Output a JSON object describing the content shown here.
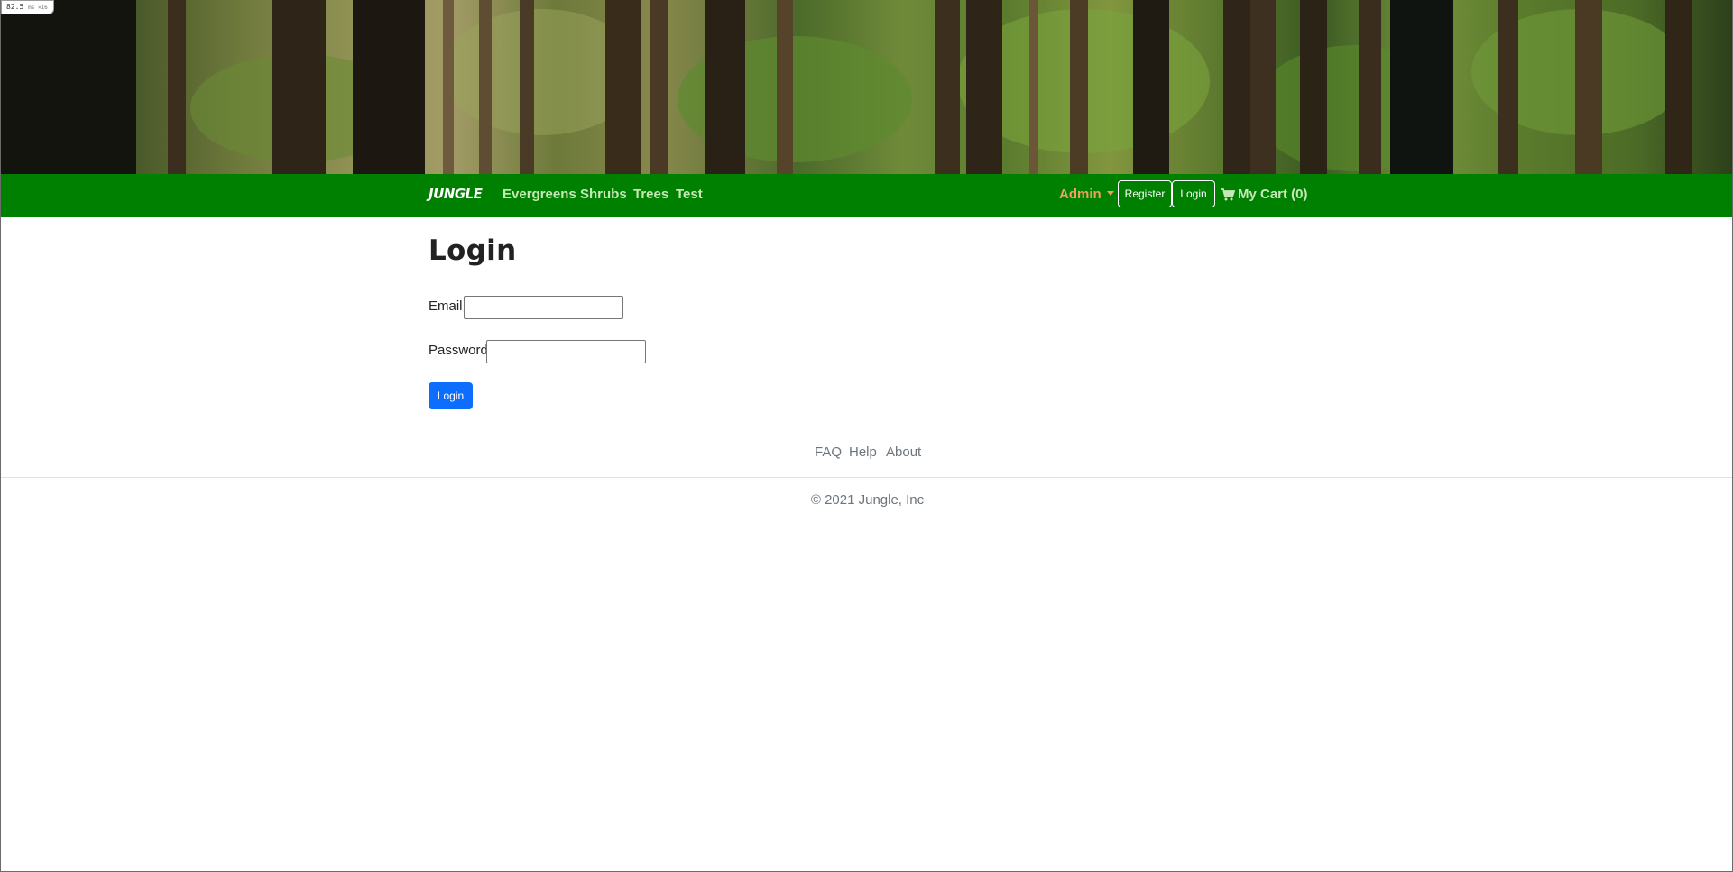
{
  "perf_badge": {
    "value": "82.5",
    "unit": "ms ×16"
  },
  "navbar": {
    "brand": "JUNGLE",
    "links": [
      {
        "label": "Evergreens"
      },
      {
        "label": "Shrubs"
      },
      {
        "label": "Trees"
      },
      {
        "label": "Test"
      }
    ],
    "admin_label": "Admin",
    "register_label": "Register",
    "login_label": "Login",
    "cart_label": "My Cart (0)",
    "colors": {
      "bar": "#008000",
      "link": "#c6e8b6",
      "admin": "#f0a060"
    }
  },
  "main": {
    "title": "Login",
    "email_label": "Email",
    "email_value": "",
    "password_label": "Password",
    "password_value": "",
    "submit_label": "Login",
    "submit_color": "#0d6efd"
  },
  "footer": {
    "links": [
      {
        "label": "FAQ"
      },
      {
        "label": "Help"
      },
      {
        "label": "About"
      }
    ],
    "copyright": "© 2021 Jungle, Inc"
  },
  "icons": {
    "cart": "shopping-cart-icon",
    "caret": "caret-down-icon"
  }
}
